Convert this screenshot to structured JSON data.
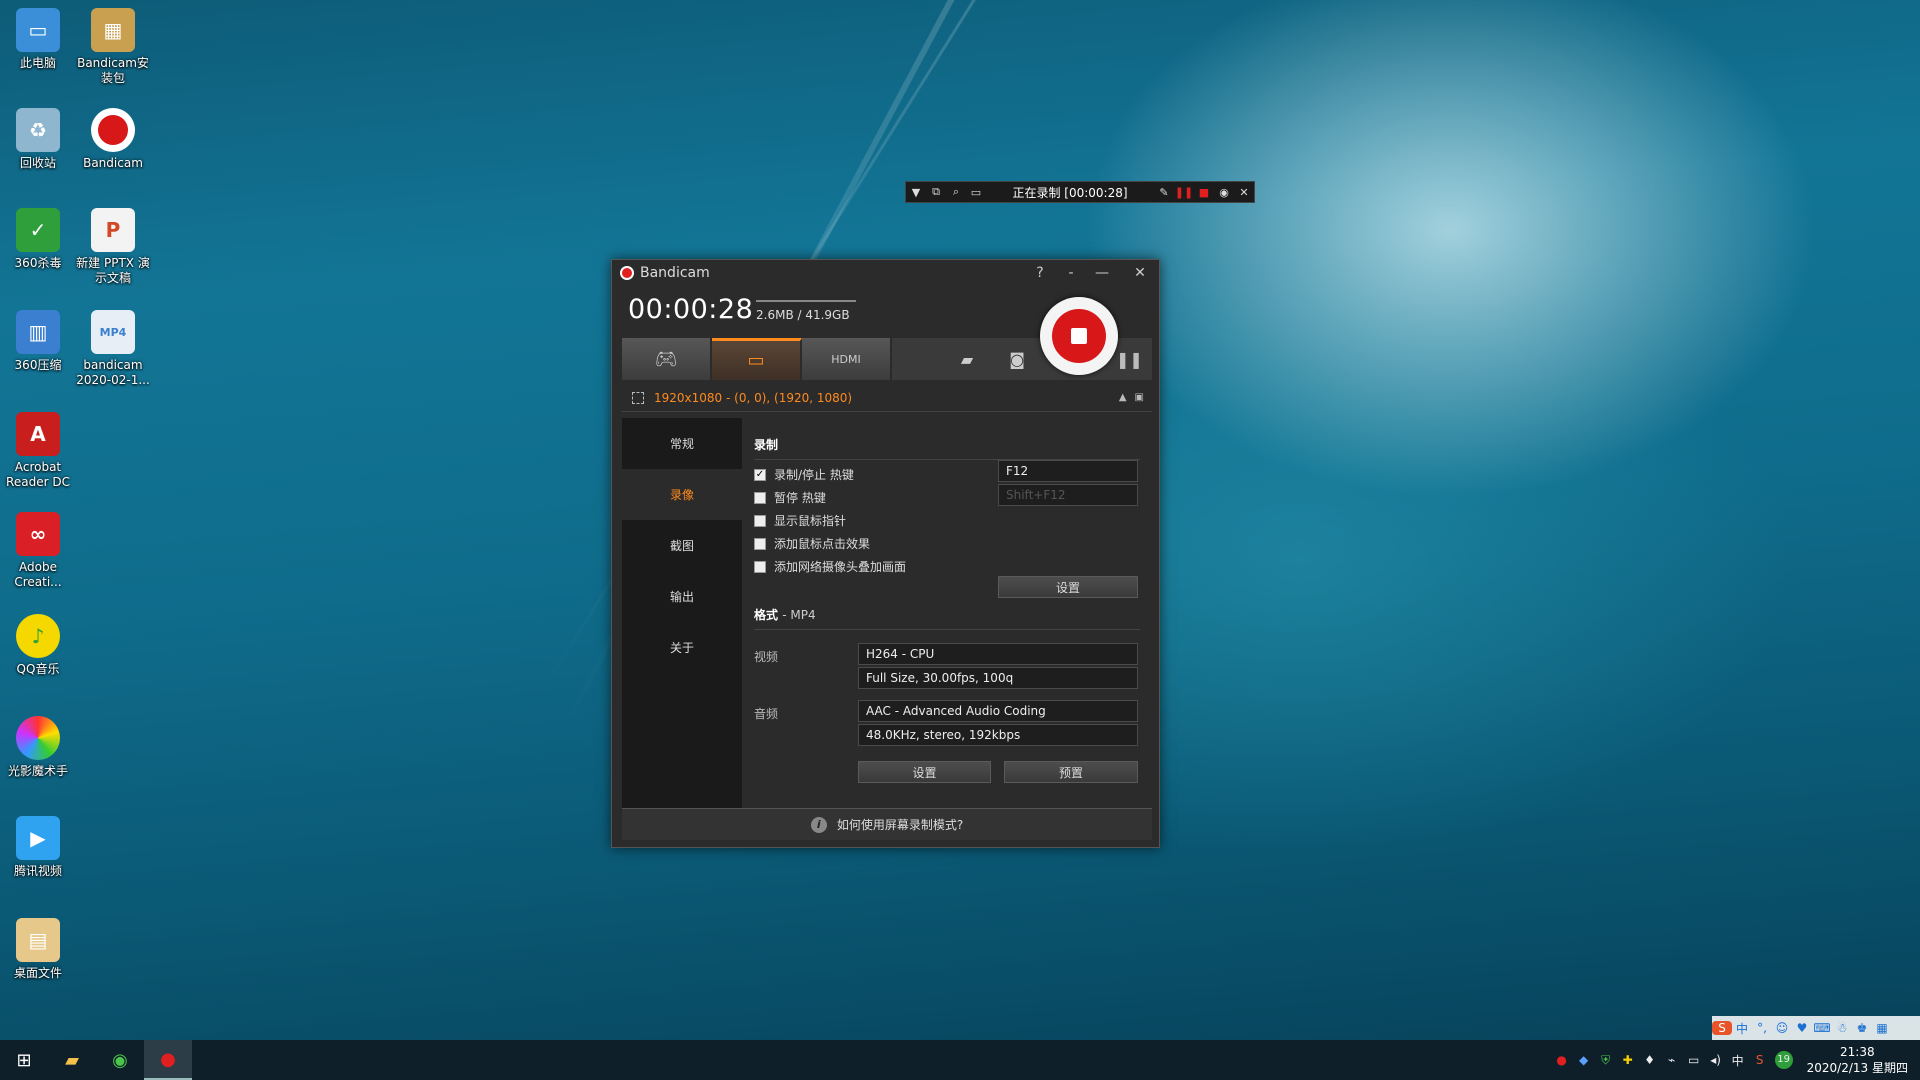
{
  "desktop": {
    "icons": [
      {
        "label": "此电脑",
        "icon": "computer-icon"
      },
      {
        "label": "Bandicam安装包",
        "icon": "package-icon"
      },
      {
        "label": "回收站",
        "icon": "recycle-bin-icon"
      },
      {
        "label": "Bandicam",
        "icon": "bandicam-icon"
      },
      {
        "label": "360杀毒",
        "icon": "antivirus-icon"
      },
      {
        "label": "新建 PPTX 演示文稿",
        "icon": "pptx-icon"
      },
      {
        "label": "360压缩",
        "icon": "archive-icon"
      },
      {
        "label": "bandicam 2020-02-1...",
        "icon": "mp4-file-icon"
      },
      {
        "label": "Acrobat Reader DC",
        "icon": "acrobat-icon"
      },
      {
        "label": "Adobe Creati...",
        "icon": "adobe-cc-icon"
      },
      {
        "label": "QQ音乐",
        "icon": "music-icon"
      },
      {
        "label": "光影魔术手",
        "icon": "photo-editor-icon"
      },
      {
        "label": "腾讯视频",
        "icon": "video-player-icon"
      },
      {
        "label": "桌面文件",
        "icon": "folder-icon"
      }
    ]
  },
  "rec_toolbar": {
    "status": "正在录制 [00:00:28]"
  },
  "window": {
    "title": "Bandicam",
    "help": "?",
    "timer": "00:00:28",
    "size": "2.6MB / 41.9GB",
    "mode_text": "1920x1080 - (0, 0), (1920, 1080)",
    "accent_color": "#ff8a1e",
    "sidebar": [
      {
        "label": "常规"
      },
      {
        "label": "录像"
      },
      {
        "label": "截图"
      },
      {
        "label": "输出"
      },
      {
        "label": "关于"
      }
    ],
    "record": {
      "title": "录制",
      "options": [
        {
          "label": "录制/停止 热键",
          "checked": true
        },
        {
          "label": "暂停 热键",
          "checked": false
        },
        {
          "label": "显示鼠标指针",
          "checked": false
        },
        {
          "label": "添加鼠标点击效果",
          "checked": false
        },
        {
          "label": "添加网络摄像头叠加画面",
          "checked": false
        }
      ],
      "hotkey_record": "F12",
      "hotkey_pause": "Shift+F12",
      "settings_btn": "设置"
    },
    "format": {
      "title": "格式",
      "container": "- MP4",
      "video_label": "视频",
      "video_codec": "H264 - CPU",
      "video_detail": "Full Size, 30.00fps, 100q",
      "audio_label": "音频",
      "audio_codec": "AAC - Advanced Audio Coding",
      "audio_detail": "48.0KHz, stereo, 192kbps",
      "settings_btn": "设置",
      "preset_btn": "预置"
    },
    "footer": "如何使用屏幕录制模式?"
  },
  "taskbar": {
    "time": "21:38",
    "date": "2020/2/13 星期四",
    "ime": "中",
    "badge": "19"
  }
}
